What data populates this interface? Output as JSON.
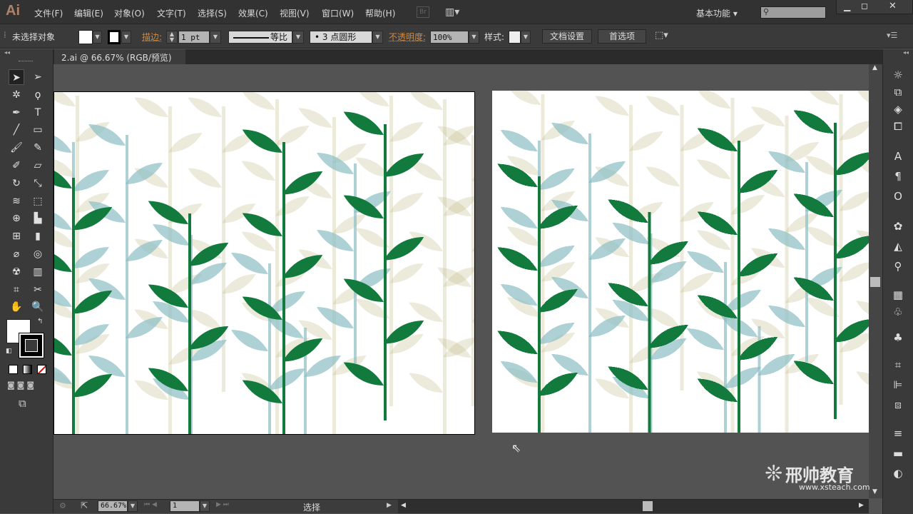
{
  "menubar": {
    "app_logo": "Ai",
    "items": [
      "文件(F)",
      "编辑(E)",
      "对象(O)",
      "文字(T)",
      "选择(S)",
      "效果(C)",
      "视图(V)",
      "窗口(W)",
      "帮助(H)"
    ],
    "bridge": "Br",
    "workspace": "基本功能",
    "search_placeholder": ""
  },
  "control": {
    "selection_status": "未选择对象",
    "stroke_label": "描边:",
    "stroke_weight": "1 pt",
    "stroke_profile": "等比",
    "brush": "3 点圆形",
    "opacity_label": "不透明度:",
    "opacity": "100%",
    "style_label": "样式:",
    "doc_setup": "文档设置",
    "preferences": "首选项"
  },
  "document_tab": {
    "title": "2.ai @ 66.67% (RGB/预览)",
    "close": "×"
  },
  "status": {
    "zoom": "66.67%",
    "artboard": "1",
    "tool": "选择"
  },
  "watermark": {
    "brand": "邢帅教育",
    "url": "www.xsteach.com"
  },
  "colors": {
    "accent_orange": "#d4893c",
    "leaf_green": "#127a3c",
    "leaf_teal": "#8cbdc4",
    "leaf_olive": "#c9c295"
  },
  "tools": [
    "selection",
    "direct-selection",
    "magic-wand",
    "lasso",
    "pen",
    "type",
    "line",
    "rectangle",
    "paintbrush",
    "pencil",
    "blob-brush",
    "eraser",
    "rotate",
    "scale",
    "width",
    "free-transform",
    "shape-builder",
    "perspective-grid",
    "mesh",
    "gradient",
    "eyedropper",
    "blend",
    "symbol-sprayer",
    "column-graph",
    "artboard",
    "slice",
    "hand",
    "zoom"
  ],
  "right_panels": [
    "color",
    "color-guide",
    "layers",
    "artboards",
    "character",
    "paragraph",
    "opentype",
    "brushes",
    "symbols",
    "graphic-styles",
    "appearance",
    "swatches",
    "stroke",
    "transform",
    "align",
    "pathfinder",
    "stroke-panel",
    "gradient",
    "transparency"
  ]
}
